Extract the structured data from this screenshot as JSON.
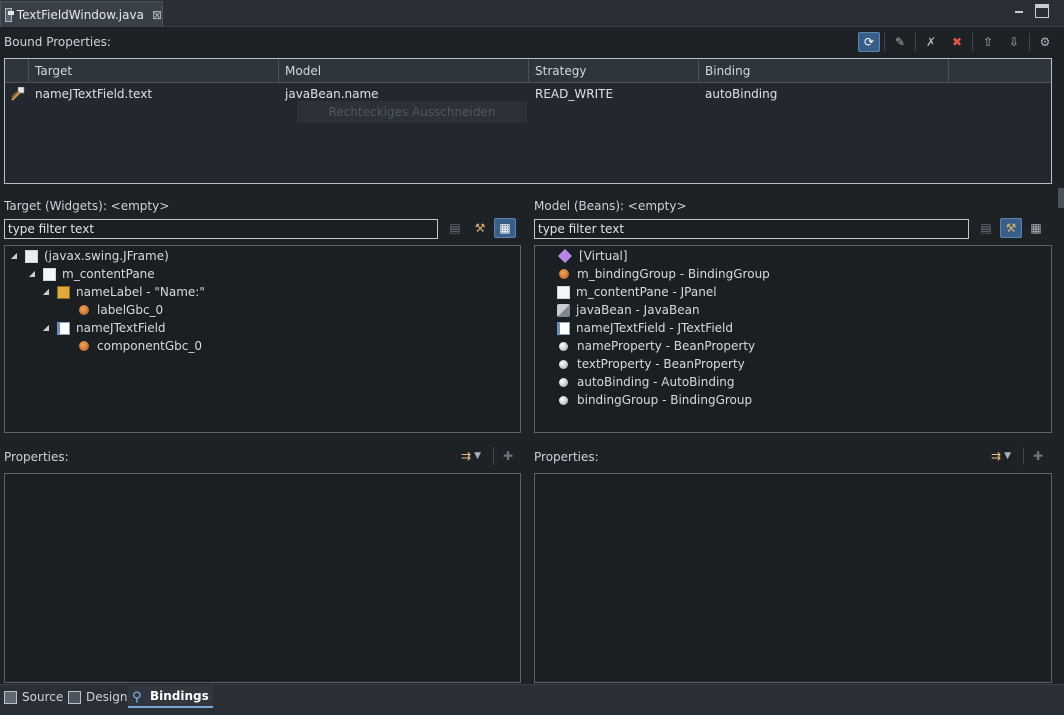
{
  "editor_tab": {
    "title": "TextFieldWindow.java",
    "close": "⊠"
  },
  "window": {
    "minimize": "▁",
    "maximize": "□"
  },
  "bound_properties": {
    "label": "Bound Properties:",
    "columns": [
      "Target",
      "Model",
      "Strategy",
      "Binding",
      ""
    ],
    "rows": [
      {
        "target": "nameJTextField.text",
        "model": "javaBean.name",
        "strategy": "READ_WRITE",
        "binding": "autoBinding"
      }
    ],
    "ghost_menu_item": "Rechteckiges Ausschneiden"
  },
  "target_panel": {
    "label": "Target (Widgets): <empty>",
    "filter_placeholder": "type filter text",
    "filter_value": "type filter text",
    "tree": [
      {
        "label": "(javax.swing.JFrame)",
        "level": 0,
        "expanded": true,
        "icon": "frame-icon"
      },
      {
        "label": "m_contentPane",
        "level": 1,
        "expanded": true,
        "icon": "panel-icon"
      },
      {
        "label": "nameLabel - \"Name:\"",
        "level": 2,
        "expanded": true,
        "icon": "label-icon"
      },
      {
        "label": "labelGbc_0",
        "level": 3,
        "expanded": null,
        "icon": "gbc-icon"
      },
      {
        "label": "nameJTextField",
        "level": 2,
        "expanded": true,
        "icon": "textfield-icon"
      },
      {
        "label": "componentGbc_0",
        "level": 3,
        "expanded": null,
        "icon": "gbc-icon"
      }
    ]
  },
  "model_panel": {
    "label": "Model (Beans): <empty>",
    "filter_placeholder": "type filter text",
    "filter_value": "type filter text",
    "tree": [
      {
        "label": "[Virtual]",
        "icon": "virtual-icon"
      },
      {
        "label": "m_bindingGroup - BindingGroup",
        "icon": "gbc-icon"
      },
      {
        "label": "m_contentPane - JPanel",
        "icon": "panel-icon"
      },
      {
        "label": "javaBean - JavaBean",
        "icon": "bean-icon"
      },
      {
        "label": "nameJTextField - JTextField",
        "icon": "textfield-icon"
      },
      {
        "label": "nameProperty - BeanProperty",
        "icon": "ball-icon"
      },
      {
        "label": "textProperty - BeanProperty",
        "icon": "ball-icon"
      },
      {
        "label": "autoBinding - AutoBinding",
        "icon": "ball-icon"
      },
      {
        "label": "bindingGroup - BindingGroup",
        "icon": "ball-icon"
      }
    ]
  },
  "properties_left": {
    "label": "Properties:"
  },
  "properties_right": {
    "label": "Properties:"
  },
  "bottom_tabs": [
    {
      "label": "Source",
      "active": false
    },
    {
      "label": "Design",
      "active": false
    },
    {
      "label": "Bindings",
      "active": true
    }
  ],
  "colors": {
    "background": "#1e2227",
    "accent": "#3a5f87",
    "border_light": "#b7bfc7"
  }
}
